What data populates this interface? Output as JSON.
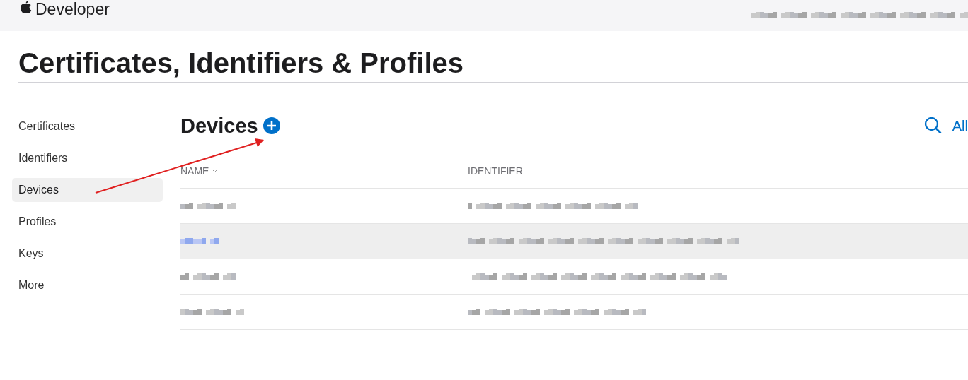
{
  "header": {
    "brand": "Developer"
  },
  "title": "Certificates, Identifiers & Profiles",
  "sidebar": {
    "items": [
      {
        "label": "Certificates",
        "selected": false
      },
      {
        "label": "Identifiers",
        "selected": false
      },
      {
        "label": "Devices",
        "selected": true
      },
      {
        "label": "Profiles",
        "selected": false
      },
      {
        "label": "Keys",
        "selected": false
      },
      {
        "label": "More",
        "selected": false
      }
    ]
  },
  "section": {
    "title": "Devices",
    "filter": "All"
  },
  "table": {
    "columns": [
      "NAME",
      "IDENTIFIER"
    ],
    "rows": [
      {
        "selected": false
      },
      {
        "selected": true
      },
      {
        "selected": false
      },
      {
        "selected": false
      }
    ]
  }
}
